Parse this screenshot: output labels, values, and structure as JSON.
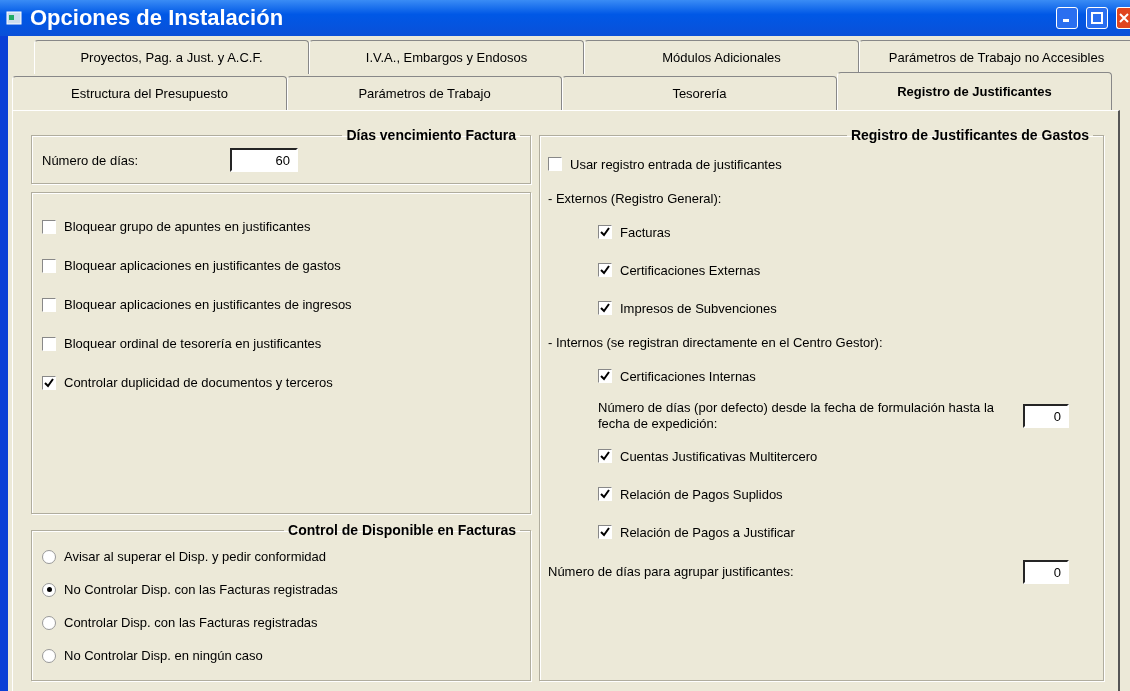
{
  "window": {
    "title": "Opciones de Instalación"
  },
  "tab_rows": [
    {
      "tabs": [
        {
          "label": "Proyectos, Pag. a Just. y A.C.F.",
          "selected": false
        },
        {
          "label": "I.V.A., Embargos y Endosos",
          "selected": false
        },
        {
          "label": "Módulos Adicionales",
          "selected": false
        },
        {
          "label": "Parámetros de Trabajo no Accesibles",
          "selected": false
        }
      ]
    },
    {
      "tabs": [
        {
          "label": "Estructura del Presupuesto",
          "selected": false
        },
        {
          "label": "Parámetros de Trabajo",
          "selected": false
        },
        {
          "label": "Tesorería",
          "selected": false
        },
        {
          "label": "Registro de Justificantes",
          "selected": true
        }
      ]
    }
  ],
  "dias_vencimiento": {
    "title": "Días vencimiento Factura",
    "label": "Número de días:",
    "value": "60"
  },
  "bloqueos": [
    {
      "label": "Bloquear grupo de apuntes en justificantes",
      "checked": false
    },
    {
      "label": "Bloquear aplicaciones en justificantes de gastos",
      "checked": false
    },
    {
      "label": "Bloquear aplicaciones en justificantes de ingresos",
      "checked": false
    },
    {
      "label": "Bloquear ordinal de tesorería en justificantes",
      "checked": false
    },
    {
      "label": "Controlar duplicidad de documentos y terceros",
      "checked": true
    }
  ],
  "control_disponible": {
    "title": "Control de Disponible en Facturas",
    "options": [
      {
        "label": "Avisar al superar el Disp. y pedir conformidad",
        "selected": false
      },
      {
        "label": "No Controlar Disp. con las Facturas registradas",
        "selected": true
      },
      {
        "label": "Controlar Disp. con las Facturas registradas",
        "selected": false
      },
      {
        "label": "No Controlar Disp. en ningún caso",
        "selected": false
      }
    ]
  },
  "registro": {
    "title": "Registro de Justificantes de Gastos",
    "items": [
      {
        "kind": "checkbox",
        "label": "Usar registro entrada de justificantes",
        "checked": false,
        "indented": false
      },
      {
        "kind": "heading",
        "label": "- Externos (Registro General):"
      },
      {
        "kind": "checkbox",
        "label": "Facturas",
        "checked": true,
        "indented": true
      },
      {
        "kind": "checkbox",
        "label": "Certificaciones Externas",
        "checked": true,
        "indented": true
      },
      {
        "kind": "checkbox",
        "label": "Impresos de Subvenciones",
        "checked": true,
        "indented": true
      },
      {
        "kind": "heading",
        "label": "- Internos (se registran directamente en el Centro Gestor):"
      },
      {
        "kind": "checkbox",
        "label": "Certificaciones Internas",
        "checked": true,
        "indented": true
      },
      {
        "kind": "number",
        "label": "Número de días (por defecto) desde la fecha de formulación hasta la fecha de expedición:",
        "value": "0",
        "indented": true
      },
      {
        "kind": "checkbox",
        "label": "Cuentas Justificativas Multitercero",
        "checked": true,
        "indented": true
      },
      {
        "kind": "checkbox",
        "label": "Relación de Pagos Suplidos",
        "checked": true,
        "indented": true
      },
      {
        "kind": "checkbox",
        "label": "Relación de Pagos a Justificar",
        "checked": true,
        "indented": true
      },
      {
        "kind": "number",
        "label": "Número de días para agrupar justificantes:",
        "value": "0",
        "indented": false
      }
    ]
  }
}
